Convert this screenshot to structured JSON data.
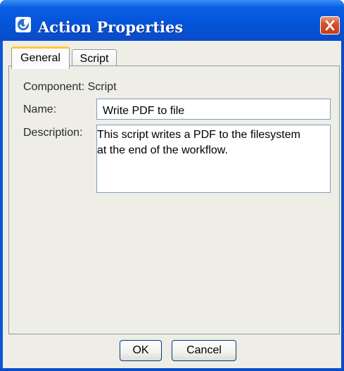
{
  "window": {
    "title": "Action Properties",
    "icon": "app-icon",
    "close_icon": "close-icon"
  },
  "tabs": [
    {
      "label": "General",
      "selected": true
    },
    {
      "label": "Script",
      "selected": false
    }
  ],
  "form": {
    "component_label": "Component:",
    "component_value": "Script",
    "name_label": "Name:",
    "name_value": "Write PDF to file",
    "description_label": "Description:",
    "description_value": "This script writes a PDF to the filesystem\nat the end of the workflow."
  },
  "buttons": {
    "ok_label": "OK",
    "cancel_label": "Cancel"
  },
  "colors": {
    "titlebar": "#0453d8",
    "tab_highlight": "#ffc83c",
    "close_button": "#c63c17",
    "dialog_background": "#eeeee7"
  }
}
